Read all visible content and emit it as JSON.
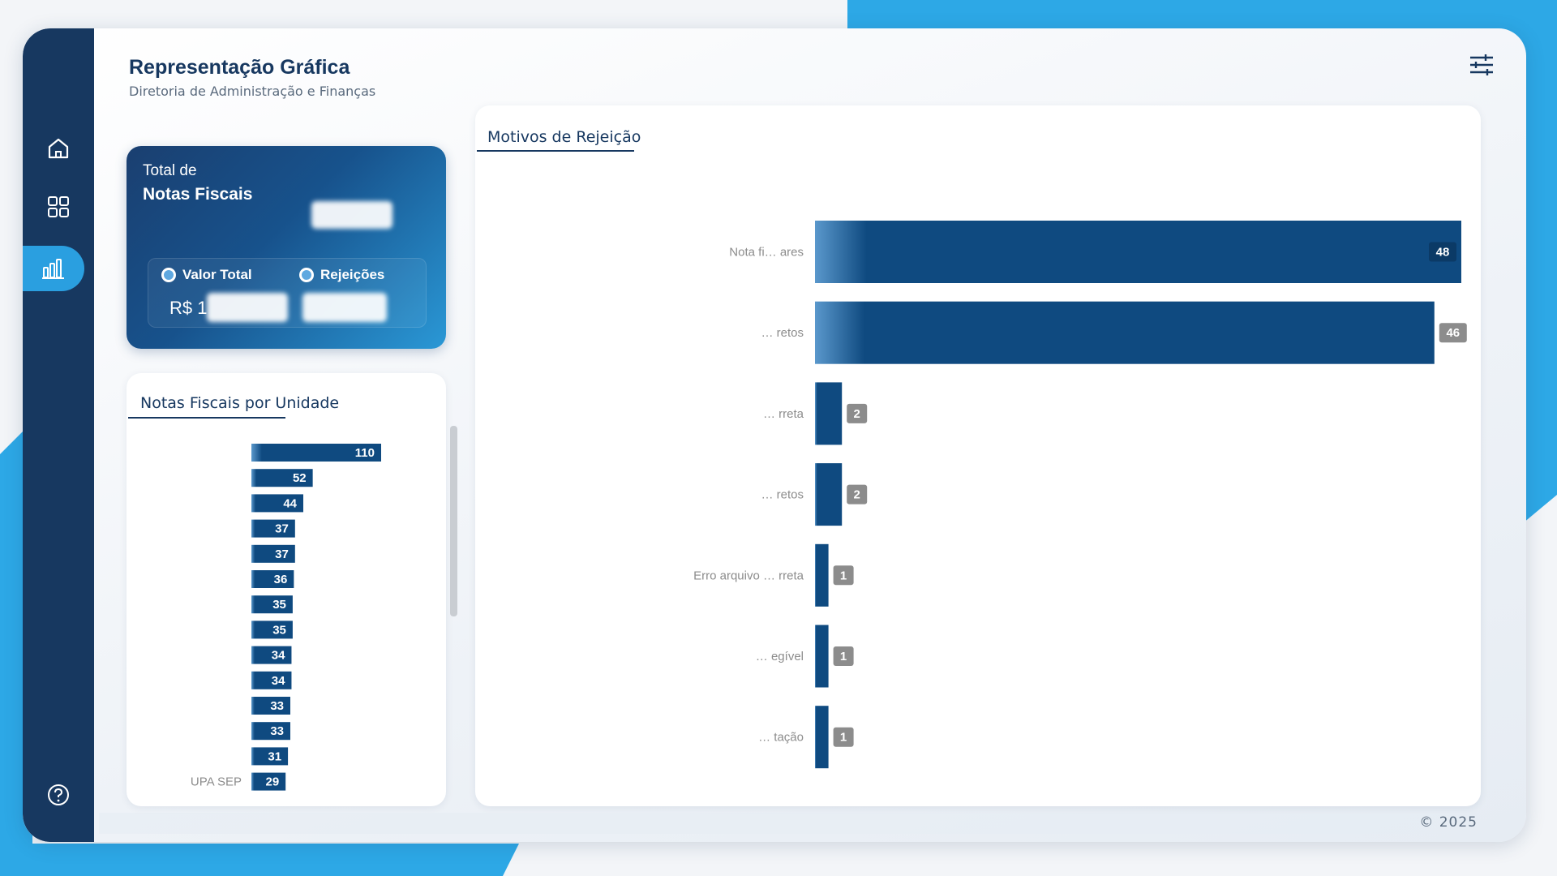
{
  "header": {
    "title": "Representação Gráfica",
    "subtitle": "Diretoria de Administração e Finanças"
  },
  "sidebar": {
    "items": [
      {
        "icon": "home-icon",
        "active": false
      },
      {
        "icon": "grid-icon",
        "active": false
      },
      {
        "icon": "bar-chart-icon",
        "active": true
      }
    ],
    "help_icon": "help-icon"
  },
  "kpi": {
    "label_line1": "Total de",
    "label_line2": "Notas Fiscais",
    "valor_total_label": "Valor Total",
    "rejeicoes_label": "Rejeições",
    "valor_prefix": "R$ 1"
  },
  "units_panel": {
    "title": "Notas Fiscais por Unidade",
    "visible_labels": [
      "UPA SEP"
    ],
    "chart_data": {
      "type": "bar",
      "orientation": "horizontal",
      "values": [
        110,
        52,
        44,
        37,
        37,
        36,
        35,
        35,
        34,
        34,
        33,
        33,
        31,
        29
      ],
      "last_category": "UPA SEP"
    }
  },
  "reasons_panel": {
    "title": "Motivos de Rejeição",
    "chart_data": {
      "type": "bar",
      "orientation": "horizontal",
      "categories_partial": [
        "Nota fi… ares",
        "… retos",
        "… rreta",
        "… retos",
        "Erro arquivo … rreta",
        "… egível",
        "… tação"
      ],
      "values": [
        48,
        46,
        2,
        2,
        1,
        1,
        1
      ]
    }
  },
  "footer": {
    "copyright": "© 2025"
  },
  "colors": {
    "navy": "#173860",
    "bar_dark": "#0f4a80",
    "accent_blue": "#2a9fe0",
    "label_gray": "#8c8c8c"
  }
}
